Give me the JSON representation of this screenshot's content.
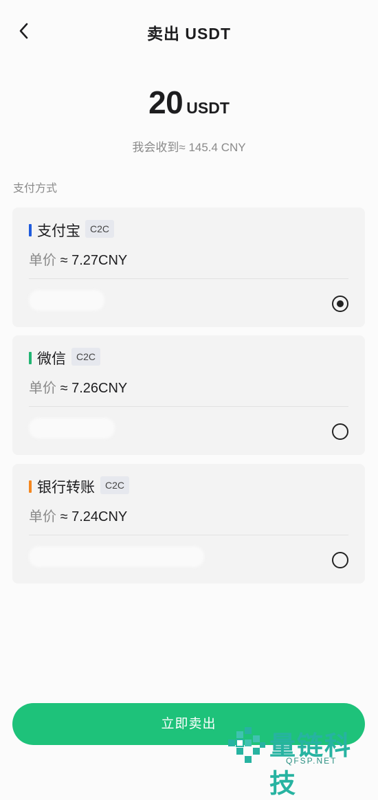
{
  "header": {
    "title": "卖出 USDT",
    "back_icon": "chevron-left-icon"
  },
  "amount": {
    "value": "20",
    "currency": "USDT"
  },
  "receive_text": "我会收到≈ 145.4 CNY",
  "section_label": "支付方式",
  "payment_methods": [
    {
      "name": "支付宝",
      "tag": "C2C",
      "price_label": "单价",
      "price_value": "≈ 7.27CNY",
      "bar_color": "#1f5bdc",
      "selected": true
    },
    {
      "name": "微信",
      "tag": "C2C",
      "price_label": "单价",
      "price_value": "≈ 7.26CNY",
      "bar_color": "#22b573",
      "selected": false
    },
    {
      "name": "银行转账",
      "tag": "C2C",
      "price_label": "单价",
      "price_value": "≈ 7.24CNY",
      "bar_color": "#f5871f",
      "selected": false
    }
  ],
  "sell_button": {
    "label": "立即卖出",
    "color": "#1ec27a"
  },
  "watermark": {
    "text": "量链科技",
    "sub": "QFSP.NET"
  }
}
